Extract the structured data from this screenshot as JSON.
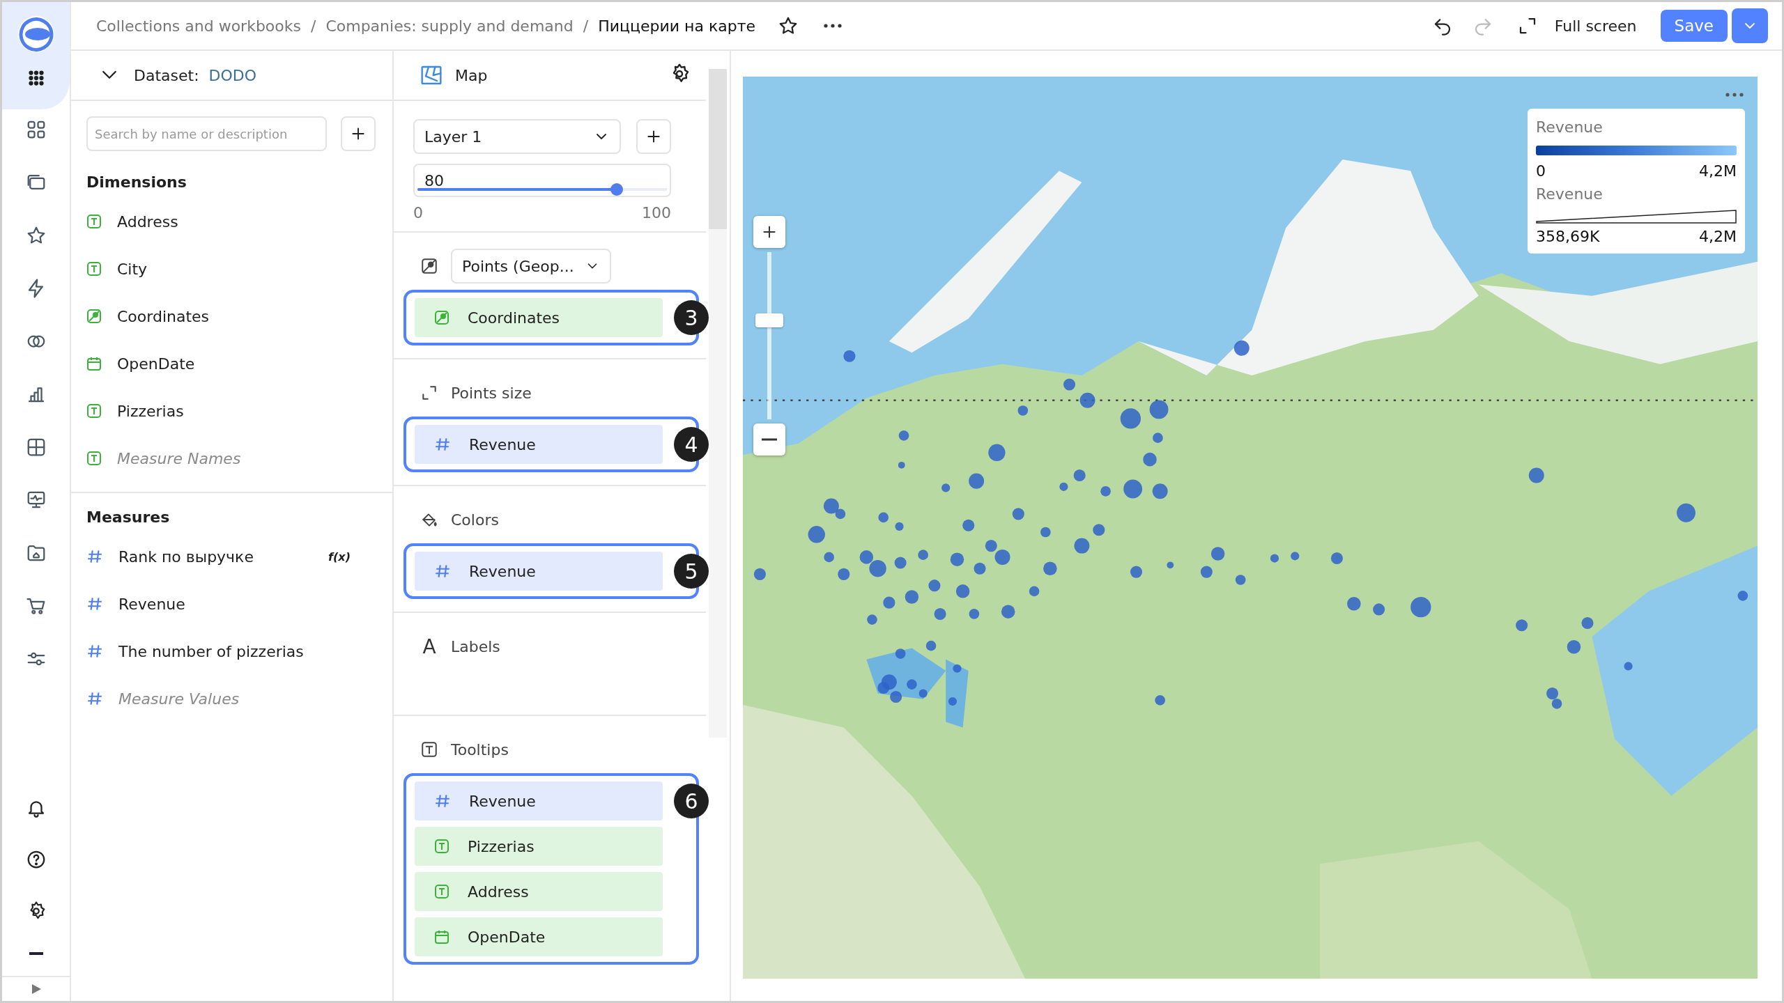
{
  "breadcrumbs": [
    {
      "label": "Collections and workbooks",
      "current": false
    },
    {
      "label": "Companies: supply and demand",
      "current": false
    },
    {
      "label": "Пиццерии на карте",
      "current": true
    }
  ],
  "breadcrumb_separator": "/",
  "zoom": {
    "level": 0.6
  },
  "toolbar": {
    "fullscreen": "Full screen",
    "save": "Save"
  },
  "dataset": {
    "label": "Dataset:",
    "name": "DODO",
    "search_placeholder": "Search by name or description"
  },
  "dimensions": {
    "title": "Dimensions",
    "items": [
      {
        "name": "Address",
        "kind": "text",
        "virtual": false
      },
      {
        "name": "City",
        "kind": "text",
        "virtual": false
      },
      {
        "name": "Coordinates",
        "kind": "geopoint",
        "virtual": false
      },
      {
        "name": "OpenDate",
        "kind": "date",
        "virtual": false
      },
      {
        "name": "Pizzerias",
        "kind": "text",
        "virtual": false
      },
      {
        "name": "Measure Names",
        "kind": "text",
        "virtual": true
      }
    ]
  },
  "measures": {
    "title": "Measures",
    "items": [
      {
        "name": "Rank по выручке",
        "kind": "number",
        "virtual": false,
        "formula": "f(x)"
      },
      {
        "name": "Revenue",
        "kind": "number",
        "virtual": false
      },
      {
        "name": "The number of pizzerias",
        "kind": "number",
        "virtual": false
      },
      {
        "name": "Measure Values",
        "kind": "number",
        "virtual": true
      }
    ]
  },
  "visualization": {
    "name": "Map",
    "layer": "Layer 1",
    "opacity": {
      "value": "80",
      "level": 0.8,
      "min": "0",
      "max": "100"
    }
  },
  "sections": [
    {
      "kind": "layer_type",
      "select": "Points (Geop...",
      "badge": "3",
      "fields": [
        {
          "name": "Coordinates",
          "kind": "geopoint"
        }
      ]
    },
    {
      "kind": "size",
      "title": "Points size",
      "badge": "4",
      "fields": [
        {
          "name": "Revenue",
          "kind": "number"
        }
      ]
    },
    {
      "kind": "colors",
      "title": "Colors",
      "badge": "5",
      "fields": [
        {
          "name": "Revenue",
          "kind": "number"
        }
      ]
    },
    {
      "kind": "labels",
      "title": "Labels",
      "icon": "A"
    },
    {
      "kind": "tooltips",
      "title": "Tooltips",
      "badge": "6",
      "fields": [
        {
          "name": "Revenue",
          "kind": "number"
        },
        {
          "name": "Pizzerias",
          "kind": "text"
        },
        {
          "name": "Address",
          "kind": "text"
        },
        {
          "name": "OpenDate",
          "kind": "date"
        }
      ]
    }
  ],
  "legend": {
    "color": {
      "title": "Revenue",
      "min": "0",
      "max": "4,2M"
    },
    "size": {
      "title": "Revenue",
      "min": "358,69K",
      "max": "4,2M"
    }
  }
}
